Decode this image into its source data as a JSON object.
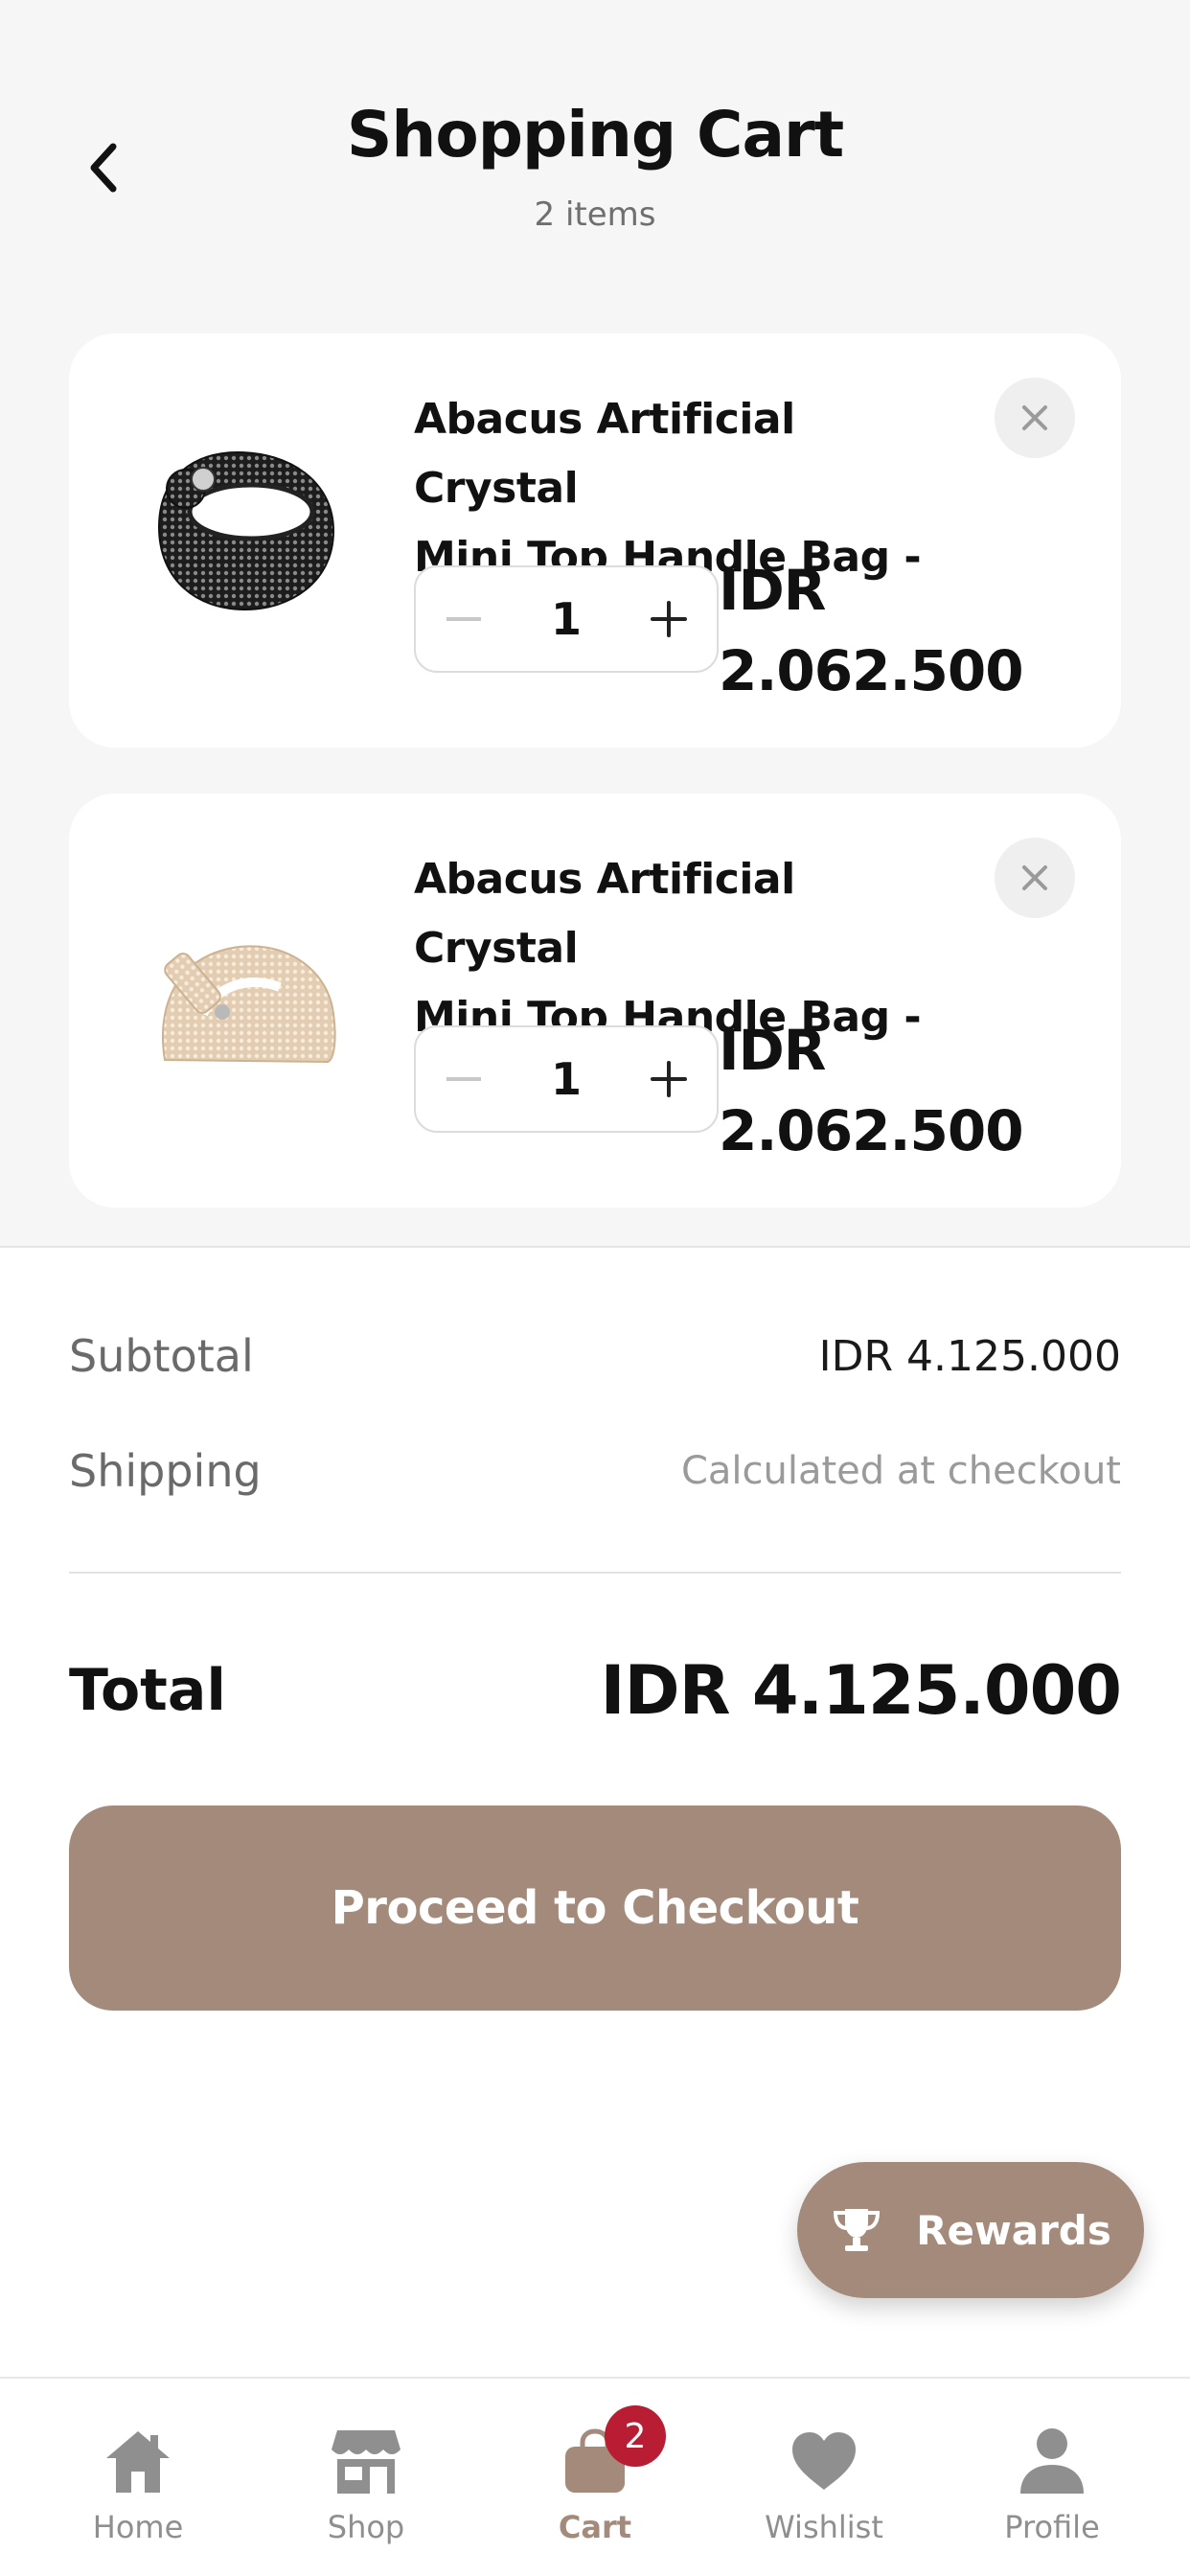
{
  "header": {
    "title": "Shopping Cart",
    "subtitle": "2 items"
  },
  "cart": {
    "items": [
      {
        "name": "Abacus Artificial Crystal\nMini Top Handle Bag - ...",
        "quantity": "1",
        "price": "IDR\n2.062.500",
        "image": "black crystal handbag"
      },
      {
        "name": "Abacus Artificial Crystal\nMini Top Handle Bag - ...",
        "quantity": "1",
        "price": "IDR\n2.062.500",
        "image": "champagne crystal handbag"
      }
    ]
  },
  "summary": {
    "subtotal_label": "Subtotal",
    "subtotal_value": "IDR 4.125.000",
    "shipping_label": "Shipping",
    "shipping_value": "Calculated at checkout",
    "total_label": "Total",
    "total_value": "IDR 4.125.000"
  },
  "checkout_label": "Proceed to Checkout",
  "rewards_label": "Rewards",
  "nav": {
    "items": [
      {
        "label": "Home",
        "icon": "home-icon"
      },
      {
        "label": "Shop",
        "icon": "shop-icon"
      },
      {
        "label": "Cart",
        "icon": "cart-icon",
        "badge": "2",
        "active": true
      },
      {
        "label": "Wishlist",
        "icon": "heart-icon"
      },
      {
        "label": "Profile",
        "icon": "profile-icon"
      }
    ]
  },
  "colors": {
    "accent": "#a48a7b",
    "badge": "#b81d34",
    "background": "#f6f6f6"
  }
}
